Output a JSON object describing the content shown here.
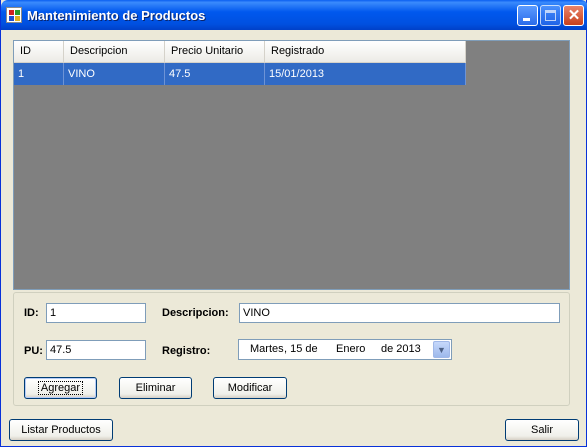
{
  "window": {
    "title": "Mantenimiento de Productos"
  },
  "grid": {
    "columns": [
      "ID",
      "Descripcion",
      "Precio Unitario",
      "Registrado"
    ],
    "rows": [
      [
        "1",
        "VINO",
        "47.5",
        "15/01/2013"
      ]
    ],
    "selected_row": 0
  },
  "form": {
    "id_label": "ID:",
    "id_value": "1",
    "descripcion_label": "Descripcion:",
    "descripcion_value": "VINO",
    "pu_label": "PU:",
    "pu_value": "47.5",
    "registro_label": "Registro:",
    "registro_value": {
      "day_name": "Martes",
      "day": ", 15 de",
      "month": "Enero",
      "year": "de 2013"
    }
  },
  "buttons": {
    "agregar": "Agregar",
    "eliminar": "Eliminar",
    "modificar": "Modificar",
    "listar": "Listar Productos",
    "salir": "Salir"
  },
  "colors": {
    "titlebar": "#0054E3",
    "selection": "#316AC5",
    "grid_background": "#808080",
    "form_background": "#ECE9D8"
  },
  "icons": {
    "dropdown": "chevron-down-icon",
    "app": "app-icon"
  }
}
